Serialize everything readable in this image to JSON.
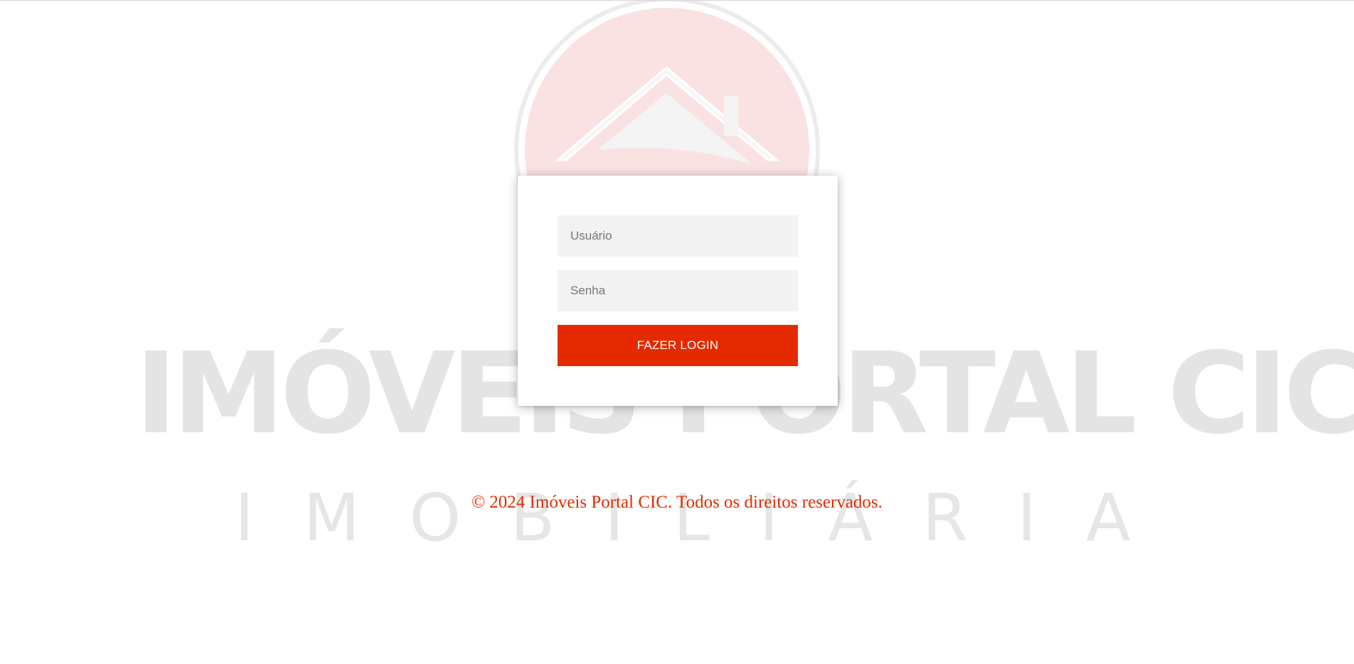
{
  "background_logo": {
    "brand_text": "IMÓVEIS PORTAL CIC",
    "sub_text_letters": [
      "I",
      "M",
      "O",
      "B",
      "I",
      "L",
      "I",
      "Á",
      "R",
      "I",
      "A"
    ],
    "emblem_icon": "house-emblem-icon",
    "emblem_color": "#e52a00"
  },
  "login": {
    "username_placeholder": "Usuário",
    "password_placeholder": "Senha",
    "submit_label": "FAZER LOGIN"
  },
  "footer": {
    "copyright": "© 2024 Imóveis Portal CIC. Todos os direitos reservados."
  },
  "colors": {
    "accent": "#e52a00",
    "field_background": "#f2f2f2",
    "page_background": "#ffffff"
  }
}
